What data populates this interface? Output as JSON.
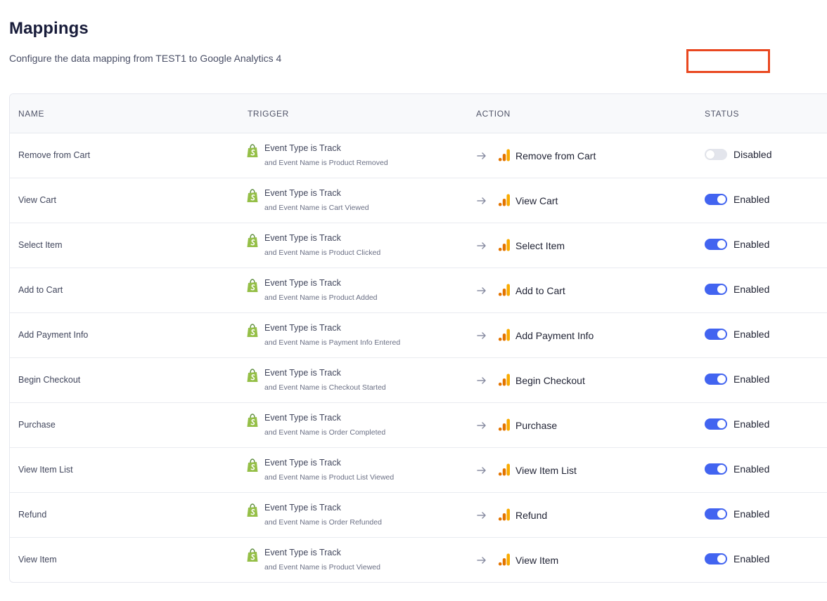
{
  "header": {
    "title": "Mappings",
    "subtitle": "Configure the data mapping from TEST1 to Google Analytics 4"
  },
  "table": {
    "columns": [
      "NAME",
      "TRIGGER",
      "ACTION",
      "STATUS"
    ],
    "rows": [
      {
        "name": "Remove from Cart",
        "trigger_main": "Event Type is Track",
        "trigger_sub": "and Event Name is Product Removed",
        "action": "Remove from Cart",
        "status": "Disabled",
        "enabled": false
      },
      {
        "name": "View Cart",
        "trigger_main": "Event Type is Track",
        "trigger_sub": "and Event Name is Cart Viewed",
        "action": "View Cart",
        "status": "Enabled",
        "enabled": true
      },
      {
        "name": "Select Item",
        "trigger_main": "Event Type is Track",
        "trigger_sub": "and Event Name is Product Clicked",
        "action": "Select Item",
        "status": "Enabled",
        "enabled": true
      },
      {
        "name": "Add to Cart",
        "trigger_main": "Event Type is Track",
        "trigger_sub": "and Event Name is Product Added",
        "action": "Add to Cart",
        "status": "Enabled",
        "enabled": true
      },
      {
        "name": "Add Payment Info",
        "trigger_main": "Event Type is Track",
        "trigger_sub": "and Event Name is Payment Info Entered",
        "action": "Add Payment Info",
        "status": "Enabled",
        "enabled": true
      },
      {
        "name": "Begin Checkout",
        "trigger_main": "Event Type is Track",
        "trigger_sub": "and Event Name is Checkout Started",
        "action": "Begin Checkout",
        "status": "Enabled",
        "enabled": true
      },
      {
        "name": "Purchase",
        "trigger_main": "Event Type is Track",
        "trigger_sub": "and Event Name is Order Completed",
        "action": "Purchase",
        "status": "Enabled",
        "enabled": true
      },
      {
        "name": "View Item List",
        "trigger_main": "Event Type is Track",
        "trigger_sub": "and Event Name is Product List Viewed",
        "action": "View Item List",
        "status": "Enabled",
        "enabled": true
      },
      {
        "name": "Refund",
        "trigger_main": "Event Type is Track",
        "trigger_sub": "and Event Name is Order Refunded",
        "action": "Refund",
        "status": "Enabled",
        "enabled": true
      },
      {
        "name": "View Item",
        "trigger_main": "Event Type is Track",
        "trigger_sub": "and Event Name is Product Viewed",
        "action": "View Item",
        "status": "Enabled",
        "enabled": true
      }
    ]
  },
  "icons": {
    "trigger": "shopify-bag-icon",
    "arrow": "arrow-right-icon",
    "action": "google-analytics-icon"
  },
  "colors": {
    "toggle_on": "#4264f0",
    "toggle_off": "#e3e5ec",
    "shopify_green": "#95bf47",
    "ga_orange": "#f9ab00",
    "highlight": "#e9471f"
  }
}
